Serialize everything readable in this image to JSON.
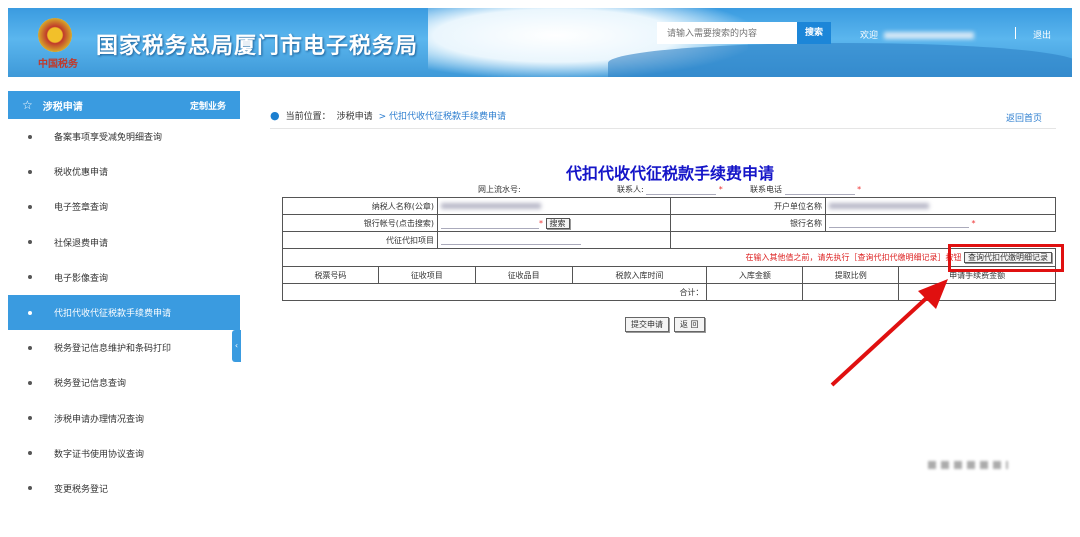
{
  "header": {
    "title": "国家税务总局厦门市电子税务局",
    "logo_text": "中国税务",
    "search_placeholder": "请输入需要搜索的内容",
    "search_button": "搜索",
    "welcome": "欢迎",
    "logout": "退出"
  },
  "sidebar": {
    "section": "涉税申请",
    "custom": "定制业务",
    "items": [
      {
        "label": "备案事项享受减免明细查询"
      },
      {
        "label": "税收优惠申请"
      },
      {
        "label": "电子签章查询"
      },
      {
        "label": "社保退费申请"
      },
      {
        "label": "电子影像查询"
      },
      {
        "label": "代扣代收代征税款手续费申请"
      },
      {
        "label": "税务登记信息维护和条码打印"
      },
      {
        "label": "税务登记信息查询"
      },
      {
        "label": "涉税申请办理情况查询"
      },
      {
        "label": "数字证书使用协议查询"
      },
      {
        "label": "变更税务登记"
      }
    ]
  },
  "breadcrumb": {
    "prefix": "当前位置：",
    "parent": "涉税申请",
    "current": "> 代扣代收代征税款手续费申请",
    "back": "返回首页"
  },
  "form": {
    "title": "代扣代收代征税款手续费申请",
    "serial_label": "网上流水号:",
    "contact_label": "联系人:",
    "phone_label": "联系电话",
    "required": "*",
    "taxpayer_label": "纳税人名称(公章)",
    "account_unit_label": "开户单位名称",
    "bank_account_label": "银行帐号(点击搜索)",
    "search_button": "搜索",
    "bank_name_label": "银行名称",
    "item_label": "代征代扣项目",
    "notice": "在输入其他值之前，请先执行［查询代扣代缴明细记录］按钮",
    "query_button": "查询代扣代缴明细记录",
    "columns": [
      "税票号码",
      "征收项目",
      "征收品目",
      "税款入库时间",
      "入库金额",
      "提取比例",
      "申请手续费金额"
    ],
    "total_label": "合计：",
    "submit": "提交申请",
    "back": "返 回"
  },
  "colors": {
    "brand": "#3a9be0",
    "title": "#1515c8",
    "highlight": "#e01010"
  }
}
